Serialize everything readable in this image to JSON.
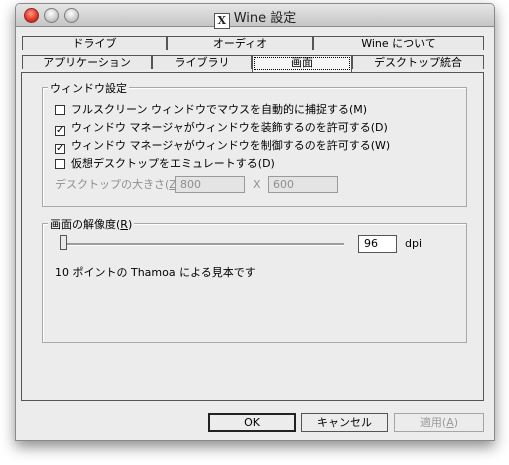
{
  "window": {
    "title_logo": "X",
    "title": "Wine 設定"
  },
  "tabs_row1": [
    {
      "label": "ドライブ"
    },
    {
      "label": "オーディオ"
    },
    {
      "label": "Wine について"
    }
  ],
  "tabs_row2": [
    {
      "label": "アプリケーション"
    },
    {
      "label": "ライブラリ"
    },
    {
      "label": "画面",
      "active": true
    },
    {
      "label": "デスクトップ統合"
    }
  ],
  "window_settings": {
    "legend": "ウィンドウ設定",
    "options": [
      {
        "label": "フルスクリーン ウィンドウでマウスを自動的に捕捉する(M)",
        "checked": false
      },
      {
        "label": "ウィンドウ マネージャがウィンドウを装飾するのを許可する(D)",
        "checked": true
      },
      {
        "label": "ウィンドウ マネージャがウィンドウを制御するのを許可する(W)",
        "checked": true
      },
      {
        "label": "仮想デスクトップをエミュレートする(D)",
        "checked": false
      }
    ],
    "desktop_size_label": "デスクトップの大きさ(",
    "desktop_size_accel": "Z",
    "desktop_size_suffix": "):",
    "width_value": "800",
    "times": "X",
    "height_value": "600"
  },
  "resolution": {
    "legend_prefix": "画面の解像度(",
    "legend_accel": "R",
    "legend_suffix": ")",
    "slider_fraction": 0.0,
    "dpi_value": "96",
    "dpi_unit": "dpi",
    "sample_text": "10 ポイントの Thamoa による見本です"
  },
  "buttons": {
    "ok": "OK",
    "cancel": "キャンセル",
    "apply_prefix": "適用(",
    "apply_accel": "A",
    "apply_suffix": ")"
  },
  "colors": {
    "window_bg": "#ececec",
    "close_button": "#e0392b"
  }
}
